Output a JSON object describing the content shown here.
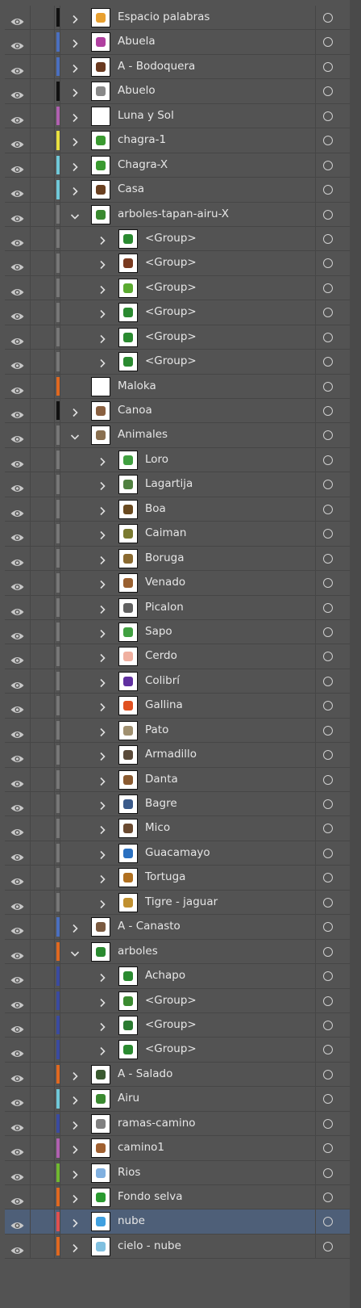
{
  "layers": [
    {
      "name": "Espacio palabras",
      "level": 0,
      "expanded": false,
      "color": "#111111",
      "thumb": "#e8a030"
    },
    {
      "name": "Abuela",
      "level": 0,
      "expanded": false,
      "color": "#4a6fbf",
      "thumb": "#b040a0"
    },
    {
      "name": "A - Bodoquera",
      "level": 0,
      "expanded": false,
      "color": "#4a6fbf",
      "thumb": "#6a3a20"
    },
    {
      "name": "Abuelo",
      "level": 0,
      "expanded": false,
      "color": "#111111",
      "thumb": "#888888"
    },
    {
      "name": "Luna y Sol",
      "level": 0,
      "expanded": false,
      "color": "#b060b0",
      "thumb": "#ffffff"
    },
    {
      "name": "chagra-1",
      "level": 0,
      "expanded": false,
      "color": "#e8e040",
      "thumb": "#3a9a30"
    },
    {
      "name": "Chagra-X",
      "level": 0,
      "expanded": false,
      "color": "#70c8d8",
      "thumb": "#3a9a30"
    },
    {
      "name": "Casa",
      "level": 0,
      "expanded": false,
      "color": "#70c8d8",
      "thumb": "#6a4020"
    },
    {
      "name": "arboles-tapan-airu-X",
      "level": 0,
      "expanded": true,
      "color": "#777777",
      "thumb": "#3a8a30"
    },
    {
      "name": "<Group>",
      "level": 1,
      "expanded": false,
      "color": "#777777",
      "thumb": "#2a8a30"
    },
    {
      "name": "<Group>",
      "level": 1,
      "expanded": false,
      "color": "#777777",
      "thumb": "#7a3a20"
    },
    {
      "name": "<Group>",
      "level": 1,
      "expanded": false,
      "color": "#777777",
      "thumb": "#5aaa30"
    },
    {
      "name": "<Group>",
      "level": 1,
      "expanded": false,
      "color": "#777777",
      "thumb": "#2a8a30"
    },
    {
      "name": "<Group>",
      "level": 1,
      "expanded": false,
      "color": "#777777",
      "thumb": "#2a8a30"
    },
    {
      "name": "<Group>",
      "level": 1,
      "expanded": false,
      "color": "#777777",
      "thumb": "#2a8a30"
    },
    {
      "name": "Maloka",
      "level": 0,
      "expanded": null,
      "color": "#e06820",
      "thumb": "#ffffff"
    },
    {
      "name": "Canoa",
      "level": 0,
      "expanded": false,
      "color": "#111111",
      "thumb": "#8a6040"
    },
    {
      "name": "Animales",
      "level": 0,
      "expanded": true,
      "color": "#777777",
      "thumb": "#8a7050"
    },
    {
      "name": "Loro",
      "level": 1,
      "expanded": false,
      "color": "#777777",
      "thumb": "#40a040"
    },
    {
      "name": "Lagartija",
      "level": 1,
      "expanded": false,
      "color": "#777777",
      "thumb": "#508040"
    },
    {
      "name": "Boa",
      "level": 1,
      "expanded": false,
      "color": "#777777",
      "thumb": "#6a4a20"
    },
    {
      "name": "Caiman",
      "level": 1,
      "expanded": false,
      "color": "#777777",
      "thumb": "#7a7a30"
    },
    {
      "name": "Boruga",
      "level": 1,
      "expanded": false,
      "color": "#777777",
      "thumb": "#8a6a30"
    },
    {
      "name": "Venado",
      "level": 1,
      "expanded": false,
      "color": "#777777",
      "thumb": "#9a6030"
    },
    {
      "name": "Picalon",
      "level": 1,
      "expanded": false,
      "color": "#777777",
      "thumb": "#606060"
    },
    {
      "name": "Sapo",
      "level": 1,
      "expanded": false,
      "color": "#777777",
      "thumb": "#40a040"
    },
    {
      "name": "Cerdo",
      "level": 1,
      "expanded": false,
      "color": "#777777",
      "thumb": "#f0b0a0"
    },
    {
      "name": "Colibrí",
      "level": 1,
      "expanded": false,
      "color": "#777777",
      "thumb": "#6030a0"
    },
    {
      "name": "Gallina",
      "level": 1,
      "expanded": false,
      "color": "#777777",
      "thumb": "#e05020"
    },
    {
      "name": "Pato",
      "level": 1,
      "expanded": false,
      "color": "#777777",
      "thumb": "#a09070"
    },
    {
      "name": "Armadillo",
      "level": 1,
      "expanded": false,
      "color": "#777777",
      "thumb": "#5a4a3a"
    },
    {
      "name": "Danta",
      "level": 1,
      "expanded": false,
      "color": "#777777",
      "thumb": "#8a5a30"
    },
    {
      "name": "Bagre",
      "level": 1,
      "expanded": false,
      "color": "#777777",
      "thumb": "#3a5a8a"
    },
    {
      "name": "Mico",
      "level": 1,
      "expanded": false,
      "color": "#777777",
      "thumb": "#6a4a30"
    },
    {
      "name": "Guacamayo",
      "level": 1,
      "expanded": false,
      "color": "#777777",
      "thumb": "#2a70c0"
    },
    {
      "name": "Tortuga",
      "level": 1,
      "expanded": false,
      "color": "#777777",
      "thumb": "#b07020"
    },
    {
      "name": "Tigre - jaguar",
      "level": 1,
      "expanded": false,
      "color": "#777777",
      "thumb": "#c09030"
    },
    {
      "name": "A - Canasto",
      "level": 0,
      "expanded": false,
      "color": "#4a6fbf",
      "thumb": "#7a5a40"
    },
    {
      "name": "arboles",
      "level": 0,
      "expanded": true,
      "color": "#e06820",
      "thumb": "#2a8a30"
    },
    {
      "name": "Achapo",
      "level": 1,
      "expanded": false,
      "color": "#3a4aa0",
      "thumb": "#2a8a30"
    },
    {
      "name": "<Group>",
      "level": 1,
      "expanded": false,
      "color": "#3a4aa0",
      "thumb": "#3a8a30"
    },
    {
      "name": "<Group>",
      "level": 1,
      "expanded": false,
      "color": "#3a4aa0",
      "thumb": "#2a7a30"
    },
    {
      "name": "<Group>",
      "level": 1,
      "expanded": false,
      "color": "#3a4aa0",
      "thumb": "#2a8a30"
    },
    {
      "name": "A - Salado",
      "level": 0,
      "expanded": false,
      "color": "#e06820",
      "thumb": "#3a5a30"
    },
    {
      "name": "Airu",
      "level": 0,
      "expanded": false,
      "color": "#70c8d8",
      "thumb": "#3a8a30"
    },
    {
      "name": "ramas-camino",
      "level": 0,
      "expanded": false,
      "color": "#3a4aa0",
      "thumb": "#808080"
    },
    {
      "name": "camino1",
      "level": 0,
      "expanded": false,
      "color": "#b060b0",
      "thumb": "#a06030"
    },
    {
      "name": "Rios",
      "level": 0,
      "expanded": false,
      "color": "#70b830",
      "thumb": "#80b0e0"
    },
    {
      "name": "Fondo selva",
      "level": 0,
      "expanded": false,
      "color": "#e06820",
      "thumb": "#2a9a30"
    },
    {
      "name": "nube",
      "level": 0,
      "expanded": false,
      "color": "#e05050",
      "thumb": "#40a0e0",
      "selected": true
    },
    {
      "name": "cielo - nube",
      "level": 0,
      "expanded": false,
      "color": "#e06820",
      "thumb": "#80c0e0"
    }
  ]
}
